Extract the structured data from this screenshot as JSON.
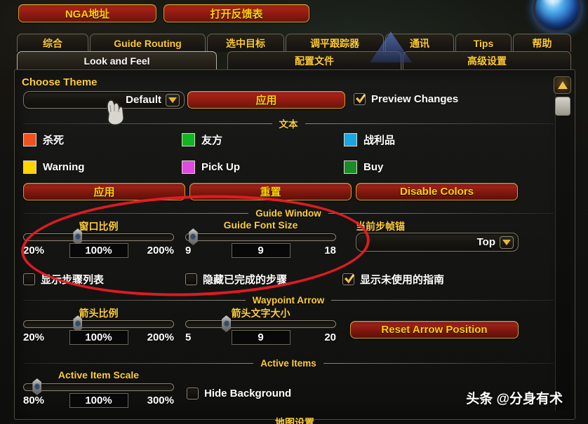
{
  "topbar": {
    "nga_label": "NGA地址",
    "feedback_label": "打开反馈表"
  },
  "tabs_row1": [
    {
      "label": "综合",
      "active": false
    },
    {
      "label": "Guide Routing",
      "active": false
    },
    {
      "label": "选中目标",
      "active": false
    },
    {
      "label": "调平跟踪器",
      "active": false
    },
    {
      "label": "通讯",
      "active": false
    },
    {
      "label": "Tips",
      "active": false
    },
    {
      "label": "帮助",
      "active": false
    }
  ],
  "tabs_row2": [
    {
      "label": "Look and Feel",
      "active": true
    },
    {
      "label": "配置文件",
      "active": false
    },
    {
      "label": "高级设置",
      "active": false
    }
  ],
  "theme": {
    "heading": "Choose Theme",
    "dropdown_value": "Default",
    "apply_label": "应用",
    "preview_label": "Preview Changes",
    "preview_checked": true
  },
  "sections": {
    "text": "文本",
    "guide_window": "Guide Window",
    "waypoint_arrow": "Waypoint Arrow",
    "active_items": "Active Items"
  },
  "colors": [
    {
      "label": "杀死",
      "hex": "#f0521f"
    },
    {
      "label": "友方",
      "hex": "#10b520"
    },
    {
      "label": "战利品",
      "hex": "#1ba6e0"
    },
    {
      "label": "Warning",
      "hex": "#ffd400"
    },
    {
      "label": "Pick Up",
      "hex": "#e04ae0"
    },
    {
      "label": "Buy",
      "hex": "#1a8c28"
    }
  ],
  "color_buttons": {
    "apply": "应用",
    "reset": "重置",
    "disable": "Disable Colors"
  },
  "guide_window": {
    "window_scale": {
      "title": "窗口比例",
      "min": "20%",
      "max": "200%",
      "value": "100%",
      "pct": 36
    },
    "font_size": {
      "title": "Guide Font Size",
      "min": "9",
      "max": "18",
      "value": "9",
      "pct": 5
    },
    "anchor": {
      "title": "当前步帧锚",
      "value": "Top"
    },
    "checkboxes": [
      {
        "label": "显示步骤列表",
        "checked": false
      },
      {
        "label": "隐藏已完成的步骤",
        "checked": false
      },
      {
        "label": "显示未使用的指南",
        "checked": true
      }
    ]
  },
  "waypoint_arrow": {
    "arrow_scale": {
      "title": "箭头比例",
      "min": "20%",
      "max": "200%",
      "value": "100%",
      "pct": 36
    },
    "arrow_font": {
      "title": "箭头文字大小",
      "min": "5",
      "max": "20",
      "value": "9",
      "pct": 27
    },
    "reset_button": "Reset Arrow Position"
  },
  "active_items": {
    "scale": {
      "title": "Active Item Scale",
      "min": "80%",
      "max": "300%",
      "value": "100%",
      "pct": 9
    },
    "hide_background": {
      "label": "Hide Background",
      "checked": false
    }
  },
  "bottom_section": "地图设置",
  "watermark": "头条 @分身有术"
}
